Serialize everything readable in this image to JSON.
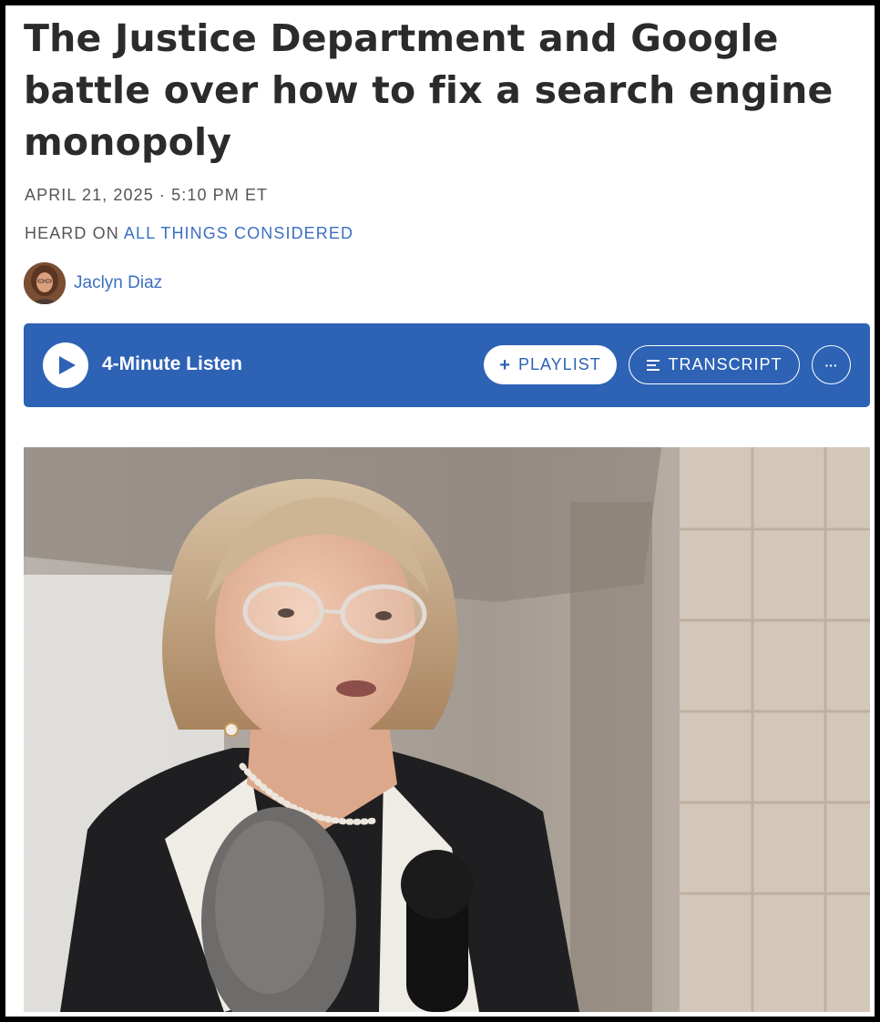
{
  "article": {
    "headline": "The Justice Department and Google battle over how to fix a search engine monopoly",
    "dateline": "APRIL 21, 2025 · 5:10 PM ET",
    "heard_on_prefix": "HEARD ON",
    "heard_on_show": "ALL THINGS CONSIDERED",
    "author": "Jaclyn Diaz"
  },
  "player": {
    "duration_label": "4-Minute Listen",
    "playlist_label": "PLAYLIST",
    "transcript_label": "TRANSCRIPT",
    "more_label": "···"
  },
  "icons": {
    "play": "play-icon",
    "plus": "plus-icon",
    "transcript": "transcript-lines-icon",
    "more": "more-options-icon"
  },
  "colors": {
    "accent": "#2d62b5",
    "link": "#3b6fc2",
    "headline": "#2b2b2b"
  }
}
